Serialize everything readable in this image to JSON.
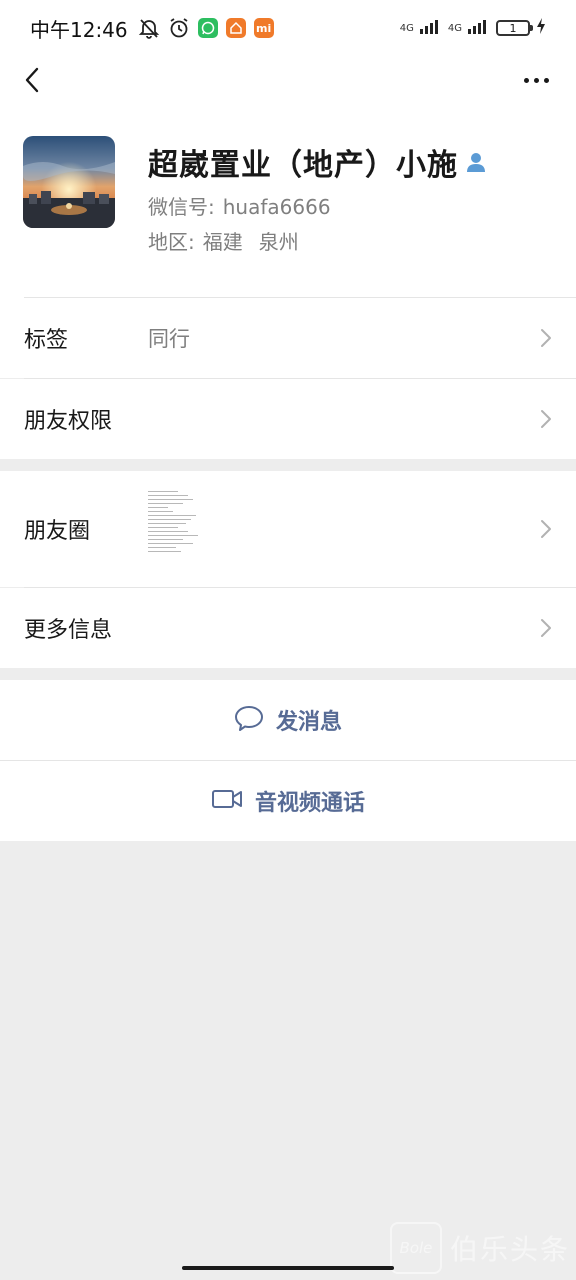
{
  "status_bar": {
    "time": "中午12:46",
    "network_1": "4G",
    "network_2": "4G",
    "battery_level": "1",
    "app_mi_label": "mi"
  },
  "nav": {
    "back_icon": "chevron-left-icon",
    "more_icon": "more-dots-icon"
  },
  "profile": {
    "name": "超崴置业（地产）小施",
    "wechat_id_label": "微信号:",
    "wechat_id": "huafa6666",
    "region_label": "地区:",
    "region_province": "福建",
    "region_city": "泉州"
  },
  "rows": {
    "tags_label": "标签",
    "tags_value": "同行",
    "permissions_label": "朋友权限",
    "moments_label": "朋友圈",
    "more_info_label": "更多信息"
  },
  "actions": {
    "send_message": "发消息",
    "video_call": "音视频通话"
  },
  "watermark": {
    "logo_text": "Bole",
    "text": "伯乐头条"
  },
  "colors": {
    "link_blue": "#576b95",
    "background": "#ededed",
    "verified_icon": "#5b9bd5"
  }
}
